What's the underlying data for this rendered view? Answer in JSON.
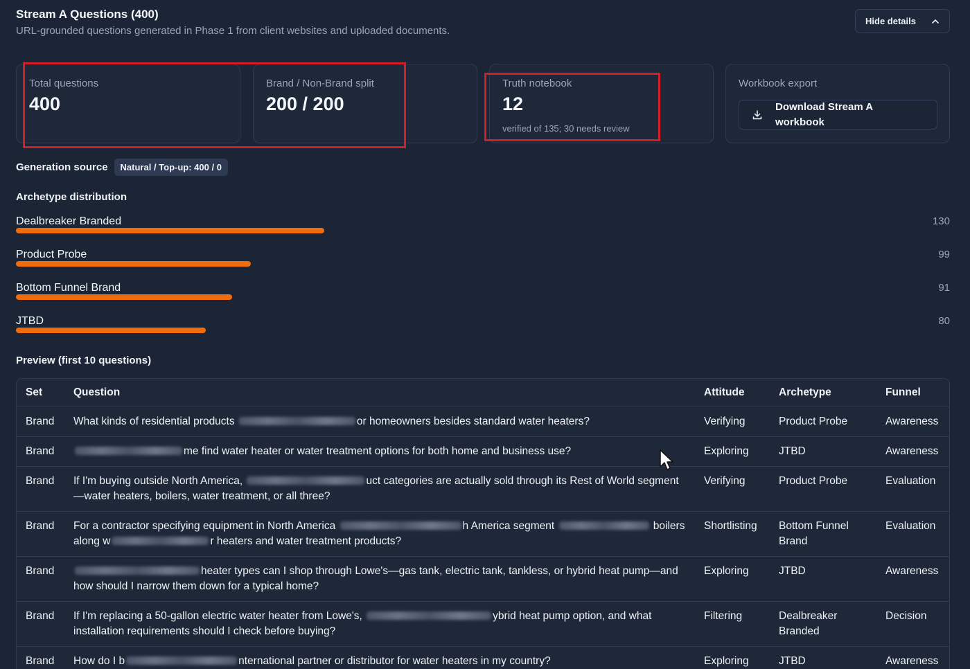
{
  "header": {
    "title": "Stream A Questions (400)",
    "subtitle": "URL-grounded questions generated in Phase 1 from client websites and uploaded documents.",
    "hide_details_label": "Hide details"
  },
  "cards": {
    "total": {
      "label": "Total questions",
      "value": "400"
    },
    "split": {
      "label": "Brand / Non-Brand split",
      "value": "200 / 200"
    },
    "truth": {
      "label": "Truth notebook",
      "value": "12",
      "note": "verified of 135; 30 needs review"
    },
    "export": {
      "label": "Workbook export",
      "button_label_1": "Download Stream A",
      "button_label_2": "workbook"
    }
  },
  "generation": {
    "label": "Generation source",
    "badge": "Natural / Top-up: 400 / 0"
  },
  "archetypes": {
    "title": "Archetype distribution",
    "items": [
      {
        "name": "Dealbreaker Branded",
        "count": "130",
        "value": 130
      },
      {
        "name": "Product Probe",
        "count": "99",
        "value": 99
      },
      {
        "name": "Bottom Funnel Brand",
        "count": "91",
        "value": 91
      },
      {
        "name": "JTBD",
        "count": "80",
        "value": 80
      }
    ]
  },
  "preview": {
    "title": "Preview (first 10 questions)",
    "columns": [
      "Set",
      "Question",
      "Attitude",
      "Archetype",
      "Funnel"
    ],
    "rows": [
      {
        "set": "Brand",
        "q": [
          "What kinds of residential products ",
          "or homeowners besides standard water heaters?"
        ],
        "attitude": "Verifying",
        "archetype": "Product Probe",
        "funnel": "Awareness"
      },
      {
        "set": "Brand",
        "q": [
          "",
          "me find water heater or water treatment options for both home and business use?"
        ],
        "attitude": "Exploring",
        "archetype": "JTBD",
        "funnel": "Awareness"
      },
      {
        "set": "Brand",
        "q": [
          "If I'm buying outside North America, ",
          "uct categories are actually sold through its Rest of World segment—water heaters, boilers, water treatment, or all three?"
        ],
        "attitude": "Verifying",
        "archetype": "Product Probe",
        "funnel": "Evaluation"
      },
      {
        "set": "Brand",
        "q": [
          "For a contractor specifying equipment in North America ",
          "h America segment ",
          " boilers along w",
          "r heaters and water treatment products?"
        ],
        "attitude": "Shortlisting",
        "archetype": "Bottom Funnel Brand",
        "funnel": "Evaluation"
      },
      {
        "set": "Brand",
        "q": [
          "",
          "heater types can I shop through Lowe's—gas tank, electric tank, tankless, or hybrid heat pump—and how should I narrow them down for a typical home?"
        ],
        "attitude": "Exploring",
        "archetype": "JTBD",
        "funnel": "Awareness"
      },
      {
        "set": "Brand",
        "q": [
          "If I'm replacing a 50-gallon electric water heater from Lowe's, ",
          "ybrid heat pump option, and what installation requirements should I check before buying?"
        ],
        "attitude": "Filtering",
        "archetype": "Dealbreaker Branded",
        "funnel": "Decision"
      },
      {
        "set": "Brand",
        "q": [
          "How do I b",
          "nternational partner or distributor for water heaters in my country?"
        ],
        "attitude": "Exploring",
        "archetype": "JTBD",
        "funnel": "Awareness"
      }
    ]
  },
  "colors": {
    "background": "#1c2535",
    "accent_bar": "#f06c0c",
    "highlight": "#d21f27"
  },
  "icons": {
    "chevron": "chevron-up-icon",
    "download": "download-icon",
    "cursor": "mouse-cursor-icon"
  }
}
